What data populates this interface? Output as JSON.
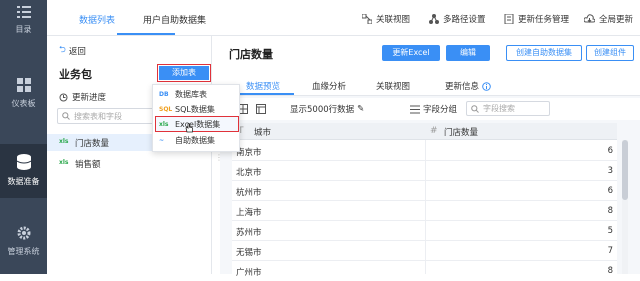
{
  "leftnav": {
    "items": [
      {
        "label": "目录",
        "icon": "menu-icon"
      },
      {
        "label": "仪表板",
        "icon": "dashboard-icon"
      },
      {
        "label": "数据准备",
        "icon": "database-icon",
        "active": true
      },
      {
        "label": "管理系统",
        "icon": "gear-icon"
      }
    ]
  },
  "topbar": {
    "tabs": [
      {
        "label": "数据列表"
      },
      {
        "label": "用户自助数据集"
      }
    ],
    "tools": [
      {
        "label": "关联视图",
        "icon": "relation-icon"
      },
      {
        "label": "多路径设置",
        "icon": "multipath-icon"
      },
      {
        "label": "更新任务管理",
        "icon": "task-icon"
      },
      {
        "label": "全局更新",
        "icon": "cloud-update-icon"
      }
    ]
  },
  "sidebar": {
    "back_label": "返回",
    "title": "业务包",
    "add_table_label": "添加表",
    "update_progress_label": "更新进度",
    "search_placeholder": "搜索表和字段",
    "tables": [
      {
        "label": "门店数量",
        "icon_text": "xls"
      },
      {
        "label": "销售额",
        "icon_text": "xls"
      }
    ]
  },
  "dropdown": {
    "items": [
      {
        "icon_text": "DB",
        "label": "数据库表"
      },
      {
        "icon_text": "SQL",
        "label": "SQL数据集"
      },
      {
        "icon_text": "xls",
        "label": "Excel数据集"
      },
      {
        "icon_text": "~",
        "label": "自助数据集"
      }
    ]
  },
  "main": {
    "title": "门店数量",
    "buttons": {
      "update_excel": "更新Excel",
      "edit": "编辑",
      "create_self": "创建自助数据集",
      "create_component": "创建组件"
    },
    "subtabs": [
      {
        "label": "数据预览"
      },
      {
        "label": "血缘分析"
      },
      {
        "label": "关联视图"
      },
      {
        "label": "更新信息"
      }
    ],
    "show_rows_label": "显示5000行数据",
    "field_group_label": "字段分组",
    "field_search_placeholder": "字段搜索",
    "columns": [
      {
        "label": "城市",
        "type_icon": "T"
      },
      {
        "label": "门店数量",
        "type_icon": "#"
      }
    ],
    "rows": [
      {
        "city": "南京市",
        "count": "6"
      },
      {
        "city": "北京市",
        "count": "3"
      },
      {
        "city": "杭州市",
        "count": "6"
      },
      {
        "city": "上海市",
        "count": "8"
      },
      {
        "city": "苏州市",
        "count": "5"
      },
      {
        "city": "无锡市",
        "count": "7"
      },
      {
        "city": "广州市",
        "count": "8"
      }
    ]
  },
  "colors": {
    "accent": "#3a8ff5",
    "nav_bg": "#3a4759",
    "highlight_red": "#e0323a"
  }
}
